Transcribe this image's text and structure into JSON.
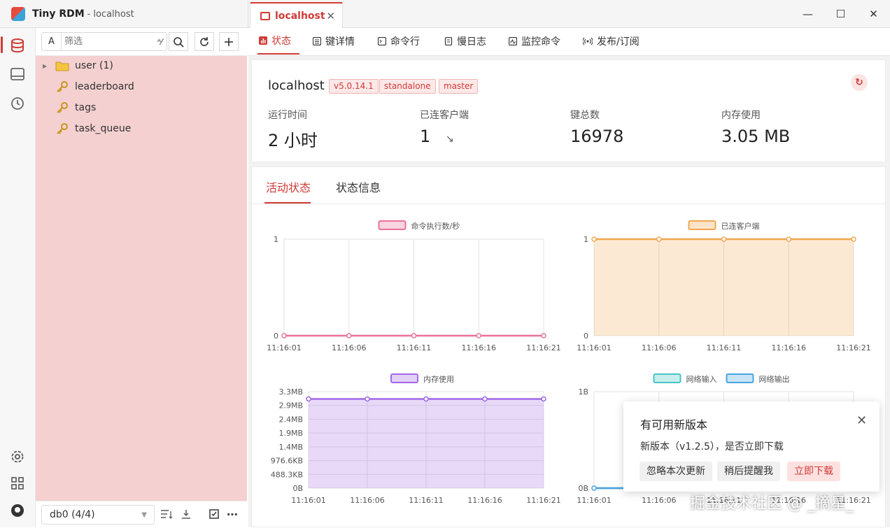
{
  "app": {
    "name": "Tiny RDM",
    "separator": "-",
    "connection": "localhost"
  },
  "connection_tab": {
    "label": "localhost"
  },
  "window_controls": {
    "minimize": "—",
    "maximize": "☐",
    "close": "✕"
  },
  "filter": {
    "case_label": "A",
    "placeholder": "筛选",
    "match_label": "ᴬ⁄"
  },
  "tree": [
    {
      "label": "user (1)",
      "type": "folder"
    },
    {
      "label": "leaderboard",
      "type": "key"
    },
    {
      "label": "tags",
      "type": "key"
    },
    {
      "label": "task_queue",
      "type": "key"
    }
  ],
  "db_select": {
    "value": "db0 (4/4)"
  },
  "nav_tabs": [
    "状态",
    "键详情",
    "命令行",
    "慢日志",
    "监控命令",
    "发布/订阅"
  ],
  "server": {
    "host": "localhost",
    "badges": [
      "v5.0.14.1",
      "standalone",
      "master"
    ],
    "stats": [
      {
        "label": "运行时间",
        "value": "2 小时"
      },
      {
        "label": "已连客户端",
        "value": "1",
        "trend": "↘"
      },
      {
        "label": "键总数",
        "value": "16978"
      },
      {
        "label": "内存使用",
        "value": "3.05 MB"
      }
    ]
  },
  "chart_tabs": {
    "active": "活动状态",
    "other": "状态信息"
  },
  "chart_data": [
    {
      "type": "line",
      "legend": [
        "命令执行数/秒"
      ],
      "x": [
        "11:16:01",
        "11:16:06",
        "11:16:11",
        "11:16:16",
        "11:16:21"
      ],
      "yticks": [
        "0",
        "1"
      ],
      "ylim": [
        0,
        1
      ],
      "series": [
        {
          "name": "命令执行数/秒",
          "values": [
            0,
            0,
            0,
            0,
            0
          ],
          "color": "#e8729a"
        }
      ]
    },
    {
      "type": "area",
      "legend": [
        "已连客户端"
      ],
      "x": [
        "11:16:01",
        "11:16:06",
        "11:16:11",
        "11:16:16",
        "11:16:21"
      ],
      "yticks": [
        "0",
        "1"
      ],
      "ylim": [
        0,
        1
      ],
      "series": [
        {
          "name": "已连客户端",
          "values": [
            1,
            1,
            1,
            1,
            1
          ],
          "color": "#f3a74f"
        }
      ]
    },
    {
      "type": "area",
      "legend": [
        "内存使用"
      ],
      "x": [
        "11:16:01",
        "11:16:06",
        "11:16:11",
        "11:16:16",
        "11:16:21"
      ],
      "yticks": [
        "0B",
        "488.3KB",
        "976.6KB",
        "1.4MB",
        "1.9MB",
        "2.4MB",
        "2.9MB",
        "3.3MB"
      ],
      "ylim": [
        0,
        3.3
      ],
      "series": [
        {
          "name": "内存使用",
          "values": [
            3.05,
            3.05,
            3.05,
            3.05,
            3.05
          ],
          "color": "#a268e8"
        }
      ]
    },
    {
      "type": "line",
      "legend": [
        "网络输入",
        "网络输出"
      ],
      "x": [
        "11:16:01",
        "11:16:06",
        "11:16:11",
        "11:16:16",
        "11:16:21"
      ],
      "yticks": [
        "0B",
        "1B"
      ],
      "ylim": [
        0,
        1
      ],
      "series": [
        {
          "name": "网络输入",
          "values": [
            0,
            0,
            0,
            0,
            0
          ],
          "color": "#48c4c4"
        },
        {
          "name": "网络输出",
          "values": [
            0,
            0,
            0,
            0,
            0
          ],
          "color": "#4aa3e0"
        }
      ]
    }
  ],
  "toast": {
    "title": "有可用新版本",
    "message": "新版本（v1.2.5），是否立即下载",
    "buttons": [
      "忽略本次更新",
      "稍后提醒我",
      "立即下载"
    ]
  },
  "watermark": "掘金技术社区 @ _摘星_",
  "colors": {
    "accent": "#d03b36",
    "sidebar_bg": "#f4d0d0"
  }
}
